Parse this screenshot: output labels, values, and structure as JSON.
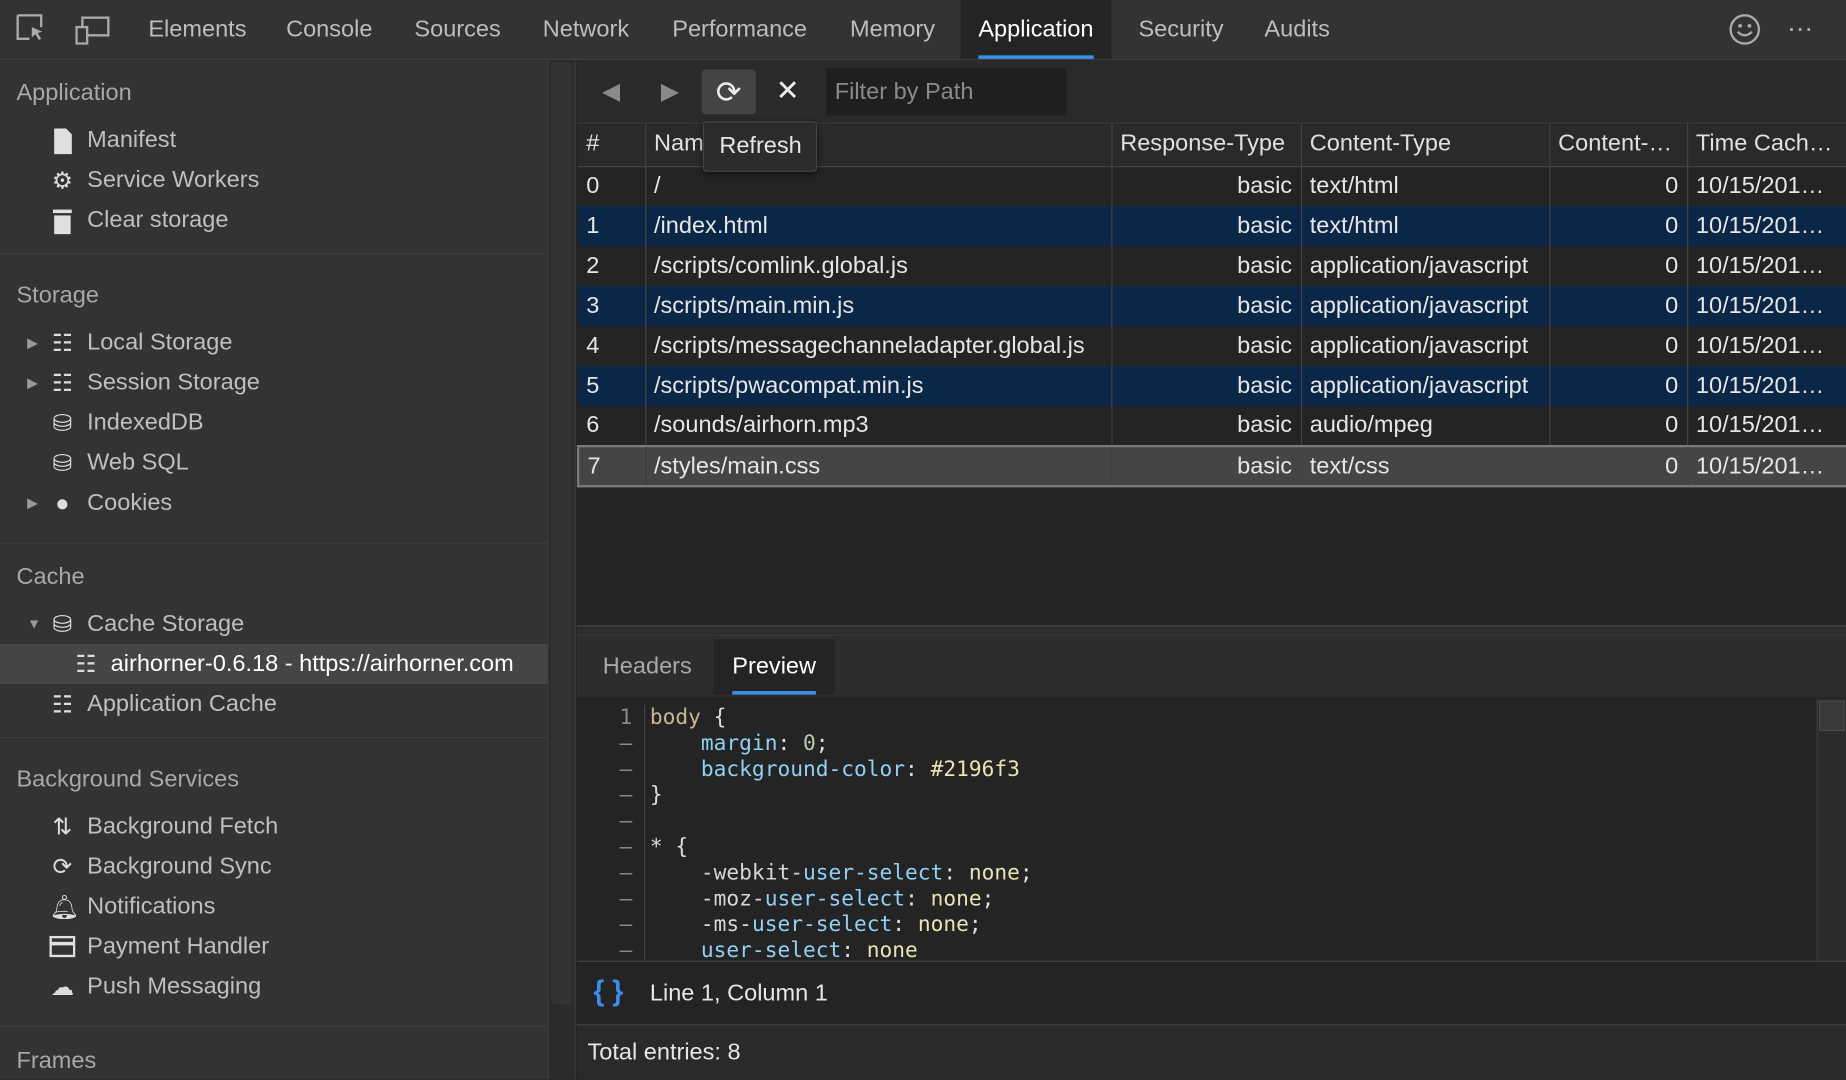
{
  "toolbar_tabs": [
    "Elements",
    "Console",
    "Sources",
    "Network",
    "Performance",
    "Memory",
    "Application",
    "Security",
    "Audits"
  ],
  "active_tab": "Application",
  "sidebar": {
    "sections": [
      "Application",
      "Storage",
      "Cache",
      "Background Services",
      "Frames"
    ],
    "application": [
      "Manifest",
      "Service Workers",
      "Clear storage"
    ],
    "storage": [
      "Local Storage",
      "Session Storage",
      "IndexedDB",
      "Web SQL",
      "Cookies"
    ],
    "cache": [
      "Cache Storage",
      "airhorner-0.6.18 - https://airhorner.com",
      "Application Cache"
    ],
    "background": [
      "Background Fetch",
      "Background Sync",
      "Notifications",
      "Payment Handler",
      "Push Messaging"
    ]
  },
  "cache_toolbar": {
    "filter_placeholder": "Filter by Path",
    "tooltip": "Refresh"
  },
  "table": {
    "headers": [
      "#",
      "Name",
      "Response-Type",
      "Content-Type",
      "Content-…",
      "Time Cach…"
    ],
    "rows": [
      [
        "0",
        "/",
        "basic",
        "text/html",
        "0",
        "10/15/201…"
      ],
      [
        "1",
        "/index.html",
        "basic",
        "text/html",
        "0",
        "10/15/201…"
      ],
      [
        "2",
        "/scripts/comlink.global.js",
        "basic",
        "application/javascript",
        "0",
        "10/15/201…"
      ],
      [
        "3",
        "/scripts/main.min.js",
        "basic",
        "application/javascript",
        "0",
        "10/15/201…"
      ],
      [
        "4",
        "/scripts/messagechanneladapter.global.js",
        "basic",
        "application/javascript",
        "0",
        "10/15/201…"
      ],
      [
        "5",
        "/scripts/pwacompat.min.js",
        "basic",
        "application/javascript",
        "0",
        "10/15/201…"
      ],
      [
        "6",
        "/sounds/airhorn.mp3",
        "basic",
        "audio/mpeg",
        "0",
        "10/15/201…"
      ],
      [
        "7",
        "/styles/main.css",
        "basic",
        "text/css",
        "0",
        "10/15/201…"
      ]
    ],
    "selected_row": 7
  },
  "detail_tabs": [
    "Headers",
    "Preview"
  ],
  "detail_active": "Preview",
  "code": {
    "line_numbers": [
      "1",
      "–",
      "–",
      "–",
      "–",
      "–",
      "–",
      "–",
      "–",
      "–"
    ],
    "l1a": "body",
    "l1b": " {",
    "l2a": "    margin",
    "l2b": ": ",
    "l2c": "0",
    "l2d": ";",
    "l3a": "    background-color",
    "l3b": ": ",
    "l3c": "#2196f3",
    "l4": "}",
    "l6": "* {",
    "l7a": "    -webkit-",
    "l7b": "user-select",
    "l7c": ": ",
    "l7d": "none",
    ";": ";",
    "l8a": "    -moz-",
    "l8b": "user-select",
    "l8c": ": ",
    "l8d": "none",
    "l9a": "    -ms-",
    "l9b": "user-select",
    "l9c": ": ",
    "l9d": "none",
    "l10a": "    user-select",
    "l10b": ": ",
    "l10c": "none"
  },
  "status": {
    "position": "Line 1, Column 1",
    "total": "Total entries: 8"
  },
  "colors": {
    "accent": "#3b8eea",
    "row_alt": "#0b2747"
  }
}
